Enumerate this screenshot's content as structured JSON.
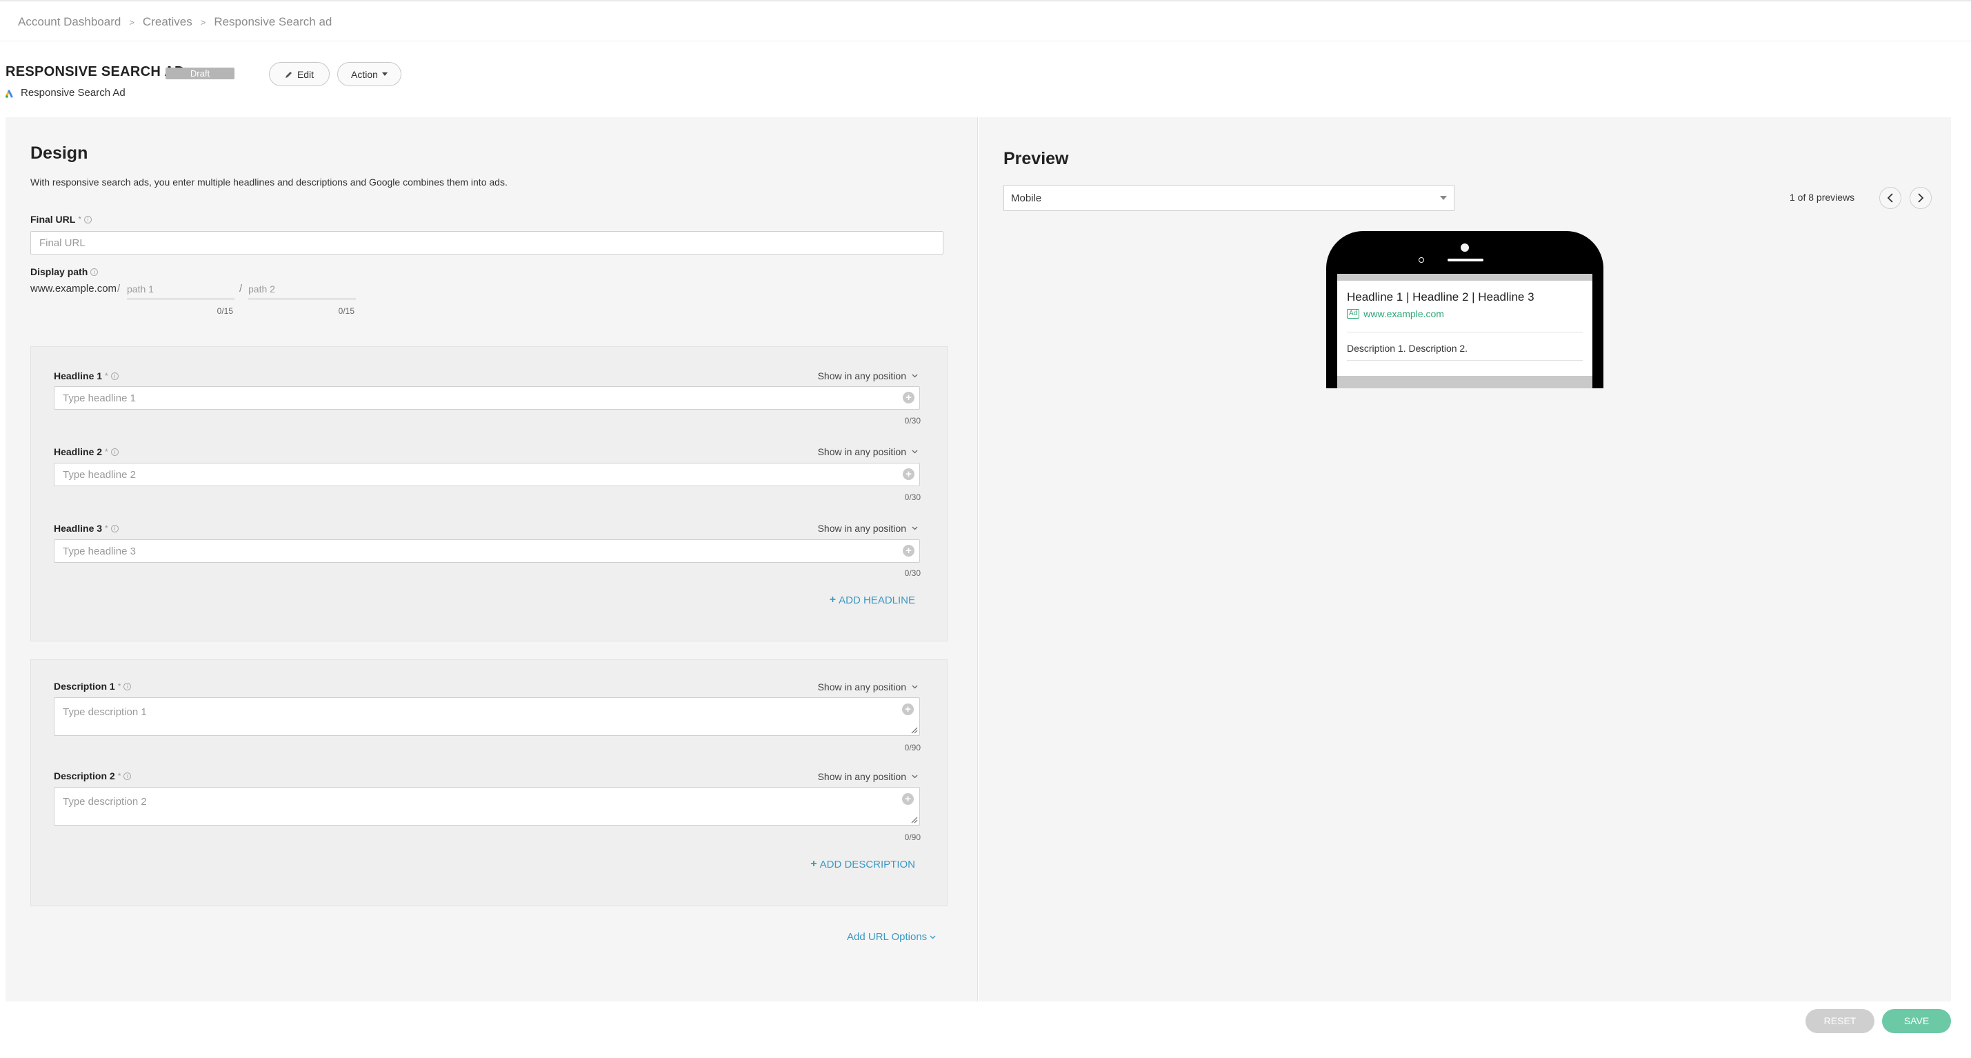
{
  "breadcrumb": [
    "Account Dashboard",
    "Creatives",
    "Responsive Search ad"
  ],
  "header": {
    "title": "RESPONSIVE SEARCH AD",
    "status": "Draft",
    "edit_label": "Edit",
    "action_label": "Action",
    "subtitle": "Responsive Search Ad"
  },
  "design": {
    "title": "Design",
    "description": "With responsive search ads, you enter multiple headlines and descriptions and Google combines them into ads.",
    "final_url": {
      "label": "Final URL",
      "required": "*",
      "placeholder": "Final URL",
      "value": ""
    },
    "display_path": {
      "label": "Display path",
      "base": "www.example.com",
      "separator": "/",
      "path1_placeholder": "path 1",
      "path2_placeholder": "path 2",
      "path1_counter": "0/15",
      "path2_counter": "0/15"
    },
    "position_label": "Show in any position",
    "headlines": [
      {
        "label": "Headline 1",
        "required": "*",
        "placeholder": "Type headline 1",
        "counter": "0/30"
      },
      {
        "label": "Headline 2",
        "required": "*",
        "placeholder": "Type headline 2",
        "counter": "0/30"
      },
      {
        "label": "Headline 3",
        "required": "*",
        "placeholder": "Type headline 3",
        "counter": "0/30"
      }
    ],
    "add_headline": "ADD HEADLINE",
    "descriptions": [
      {
        "label": "Description 1",
        "required": "*",
        "placeholder": "Type description 1",
        "counter": "0/90"
      },
      {
        "label": "Description 2",
        "required": "*",
        "placeholder": "Type description 2",
        "counter": "0/90"
      }
    ],
    "add_description": "ADD DESCRIPTION",
    "add_url_options": "Add URL Options"
  },
  "preview": {
    "title": "Preview",
    "device": "Mobile",
    "count": "1 of 8 previews",
    "ad": {
      "headline": "Headline 1 | Headline 2 | Headline 3",
      "badge": "Ad",
      "url": "www.example.com",
      "description": "Description 1. Description 2."
    }
  },
  "footer": {
    "reset": "RESET",
    "save": "SAVE"
  },
  "colors": {
    "accent": "#3a98c4",
    "save": "#6cc9a6",
    "ad_green": "#2ea676",
    "badge_grey": "#b5b5b5"
  }
}
